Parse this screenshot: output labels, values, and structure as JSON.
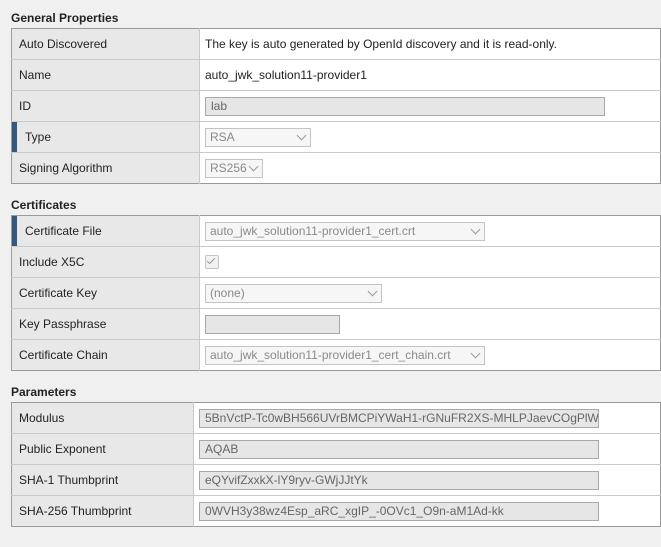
{
  "general": {
    "title": "General Properties",
    "auto_discovered_label": "Auto Discovered",
    "auto_discovered_value": "The key is auto generated by OpenId discovery and it is read-only.",
    "name_label": "Name",
    "name_value": "auto_jwk_solution11-provider1",
    "id_label": "ID",
    "id_value": "lab",
    "type_label": "Type",
    "type_value": "RSA",
    "signing_label": "Signing Algorithm",
    "signing_value": "RS256"
  },
  "certificates": {
    "title": "Certificates",
    "file_label": "Certificate File",
    "file_value": "auto_jwk_solution11-provider1_cert.crt",
    "x5c_label": "Include X5C",
    "x5c_checked": true,
    "key_label": "Certificate Key",
    "key_value": "(none)",
    "passphrase_label": "Key Passphrase",
    "passphrase_value": "",
    "chain_label": "Certificate Chain",
    "chain_value": "auto_jwk_solution11-provider1_cert_chain.crt"
  },
  "parameters": {
    "title": "Parameters",
    "modulus_label": "Modulus",
    "modulus_value": "5BnVctP-Tc0wBH566UVrBMCPiYWaH1-rGNuFR2XS-MHLPJaevCOgPlW",
    "exponent_label": "Public Exponent",
    "exponent_value": "AQAB",
    "sha1_label": "SHA-1 Thumbprint",
    "sha1_value": "eQYvifZxxkX-lY9ryv-GWjJJtYk",
    "sha256_label": "SHA-256 Thumbprint",
    "sha256_value": "0WVH3y38wz4Esp_aRC_xgIP_-0OVc1_O9n-aM1Ad-kk"
  },
  "colors": {
    "required_bar": "#34587e",
    "label_bg": "#e8e8e8"
  }
}
